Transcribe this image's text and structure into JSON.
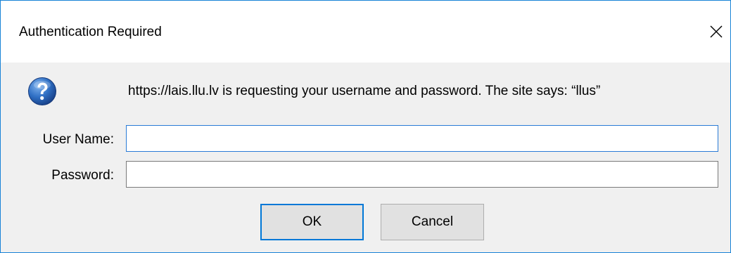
{
  "dialog": {
    "title": "Authentication Required",
    "close_icon": "close-icon",
    "question_icon": "question-icon",
    "message": "https://lais.llu.lv is requesting your username and password. The site says: “llus”",
    "username_label": "User Name:",
    "username_value": "",
    "password_label": "Password:",
    "password_value": "",
    "ok_label": "OK",
    "cancel_label": "Cancel"
  },
  "colors": {
    "window_border": "#1883d7",
    "background": "#f0f0f0",
    "focus_accent": "#0078d7",
    "icon_blue": "#1a5fb4"
  }
}
